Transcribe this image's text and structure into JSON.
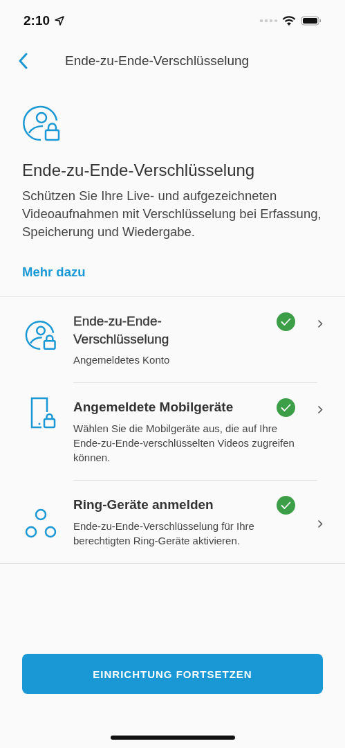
{
  "status_bar": {
    "time": "2:10"
  },
  "nav": {
    "title": "Ende-zu-Ende-Verschlüsselung"
  },
  "intro": {
    "title": "Ende-zu-Ende-Verschlüsselung",
    "text": "Schützen Sie Ihre Live- und aufgezeichneten Videoaufnahmen mit Verschlüsselung bei Erfassung, Speicherung und Wiedergabe.",
    "link": "Mehr dazu"
  },
  "items": [
    {
      "kind": "account",
      "title": "Ende-zu-Ende-Verschlüsselung",
      "subtitle": "Angemeldetes Konto",
      "done": true
    },
    {
      "kind": "phone",
      "title": "Angemeldete Mobilgeräte",
      "subtitle": "Wählen Sie die Mobilgeräte aus, die auf Ihre Ende-zu-Ende-verschlüsselten Videos zugreifen können.",
      "done": true
    },
    {
      "kind": "devices",
      "title": "Ring-Geräte anmelden",
      "subtitle": "Ende-zu-Ende-Verschlüsselung für Ihre berechtigten Ring-Geräte aktivieren.",
      "done": true
    }
  ],
  "button": {
    "label": "EINRICHTUNG FORTSETZEN"
  }
}
